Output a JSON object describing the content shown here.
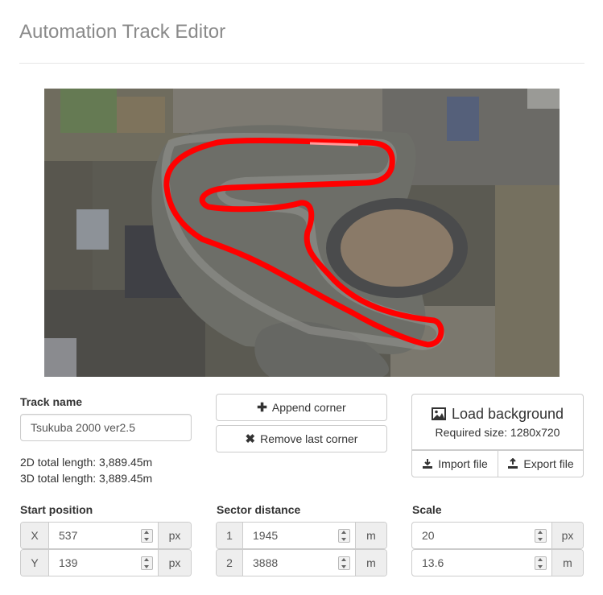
{
  "app": {
    "title": "Automation Track Editor"
  },
  "track": {
    "name_label": "Track name",
    "name_value": "Tsukuba 2000 ver2.5",
    "length_2d": "2D total length: 3,889.45m",
    "length_3d": "3D total length: 3,889.45m"
  },
  "actions": {
    "append_corner": "Append corner",
    "remove_last_corner": "Remove last corner",
    "load_background": "Load background",
    "required_size": "Required size: 1280x720",
    "import_file": "Import file",
    "export_file": "Export file"
  },
  "start_position": {
    "label": "Start position",
    "x_label": "X",
    "x_value": "537",
    "x_unit": "px",
    "y_label": "Y",
    "y_value": "139",
    "y_unit": "px"
  },
  "sector_distance": {
    "label": "Sector distance",
    "s1_label": "1",
    "s1_value": "1945",
    "s1_unit": "m",
    "s2_label": "2",
    "s2_value": "3888",
    "s2_unit": "m"
  },
  "scale": {
    "label": "Scale",
    "px_value": "20",
    "px_unit": "px",
    "m_value": "13.6",
    "m_unit": "m"
  },
  "colors": {
    "track_line": "#ff0000"
  },
  "icons": [
    "plus-icon",
    "x-icon",
    "image-icon",
    "import-icon",
    "export-icon",
    "spinner-icon"
  ]
}
